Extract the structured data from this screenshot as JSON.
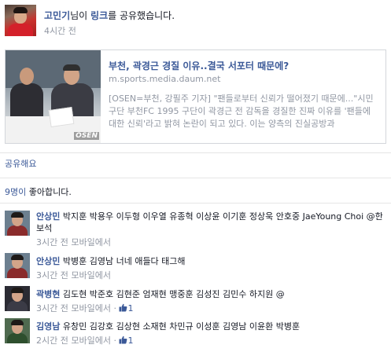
{
  "post": {
    "author": "고민기",
    "action_suffix": "님이 ",
    "link_word": "링크",
    "action_end": "를 공유했습니다.",
    "time": "4시간 전"
  },
  "link_card": {
    "title": "부천, 곽경근 경질 이유..결국 서포터 때문에?",
    "domain": "m.sports.media.daum.net",
    "description": "[OSEN=부천, 강필주 기자] \"팬들로부터 신뢰가 떨어졌기 때문에...\"시민구단 부천FC 1995 구단이 곽경근 전 감독을 경질한 진짜 이유를 '팬들에 대한 신뢰'라고 밝혀 논란이 되고 있다. 이는 양측의 진실공방과",
    "thumbnail_logo": "OSEN"
  },
  "actions": {
    "share": "공유해요"
  },
  "likes": {
    "count_link": "9명이",
    "suffix": " 좋아합니다."
  },
  "comments": [
    {
      "author": "안상민",
      "text": " 박지훈 박용우 이두형 이우열 유종혁 이상윤 이기훈 정상욱 안호중 JaeYoung Choi @한보석",
      "meta": "3시간 전 모바일에서",
      "likes": "",
      "avatar_color": "#8a2b2b"
    },
    {
      "author": "안상민",
      "text": " 박병훈 김영남 너네 애들다 태그해",
      "meta": "3시간 전 모바일에서",
      "likes": "",
      "avatar_color": "#8a2b2b"
    },
    {
      "author": "곽병현",
      "text": " 김도현 박준호 김현준 엄재현 맹중훈 김성진 김민수 하지원 @",
      "meta": "3시간 전 모바일에서 · ",
      "likes": "1",
      "avatar_color": "#3b3b46"
    },
    {
      "author": "김영남",
      "text": " 유창민 김강호 김상현 소재현 차민규 이성훈 김영남 이윤환 박병훈",
      "meta": "2시간 전 모바일에서 · ",
      "likes": "1",
      "avatar_color": "#2e4f2e"
    }
  ]
}
